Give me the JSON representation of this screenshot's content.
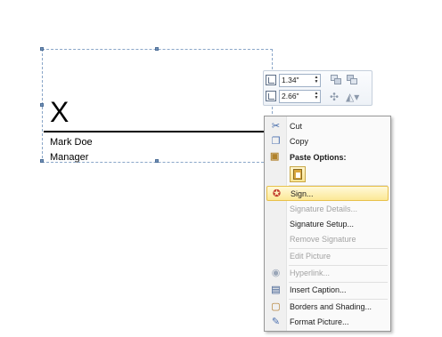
{
  "signature_line": {
    "x_mark": "X",
    "signer_name": "Mark Doe",
    "signer_title": "Manager"
  },
  "size_toolbar": {
    "height_value": "1.34\"",
    "width_value": "2.66\"",
    "spin_up": "▲",
    "spin_down": "▼"
  },
  "context_menu": {
    "items": [
      {
        "label": "Cut",
        "icon": "scissors-icon",
        "enabled": true
      },
      {
        "label": "Copy",
        "icon": "copy-icon",
        "enabled": true
      },
      {
        "label": "Paste Options:",
        "icon": "paste-icon",
        "enabled": true,
        "header": true
      },
      {
        "label": "Sign...",
        "icon": "sign-ribbon-icon",
        "enabled": true,
        "highlighted": true
      },
      {
        "label": "Signature Details...",
        "enabled": false
      },
      {
        "label": "Signature Setup...",
        "enabled": true
      },
      {
        "label": "Remove Signature",
        "enabled": false
      },
      {
        "label": "Edit Picture",
        "enabled": false
      },
      {
        "label": "Hyperlink...",
        "icon": "hyperlink-icon",
        "enabled": false
      },
      {
        "label": "Insert Caption...",
        "icon": "insert-caption-icon",
        "enabled": true
      },
      {
        "label": "Borders and Shading...",
        "icon": "borders-shading-icon",
        "enabled": true
      },
      {
        "label": "Format Picture...",
        "icon": "format-picture-icon",
        "enabled": true
      }
    ]
  },
  "colors": {
    "selection_border": "#8aa6c8",
    "highlight_fill": "#fce896",
    "highlight_border": "#e8c14b",
    "disabled_text": "#a3a3a3"
  }
}
